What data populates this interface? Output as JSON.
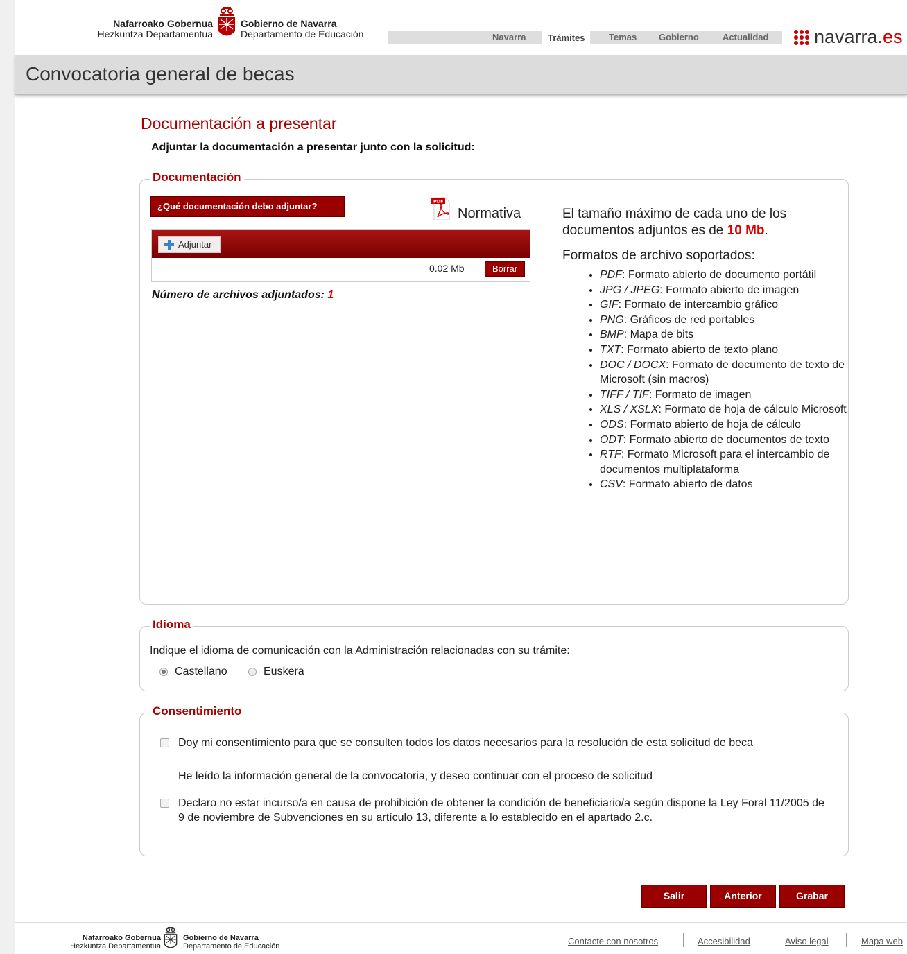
{
  "header": {
    "org_left_bold": "Nafarroako Gobernua",
    "org_left_sub": "Hezkuntza Departamentua",
    "org_right_bold": "Gobierno de Navarra",
    "org_right_sub": "Departamento de Educación",
    "nav": [
      "Navarra",
      "Trámites",
      "Temas",
      "Gobierno",
      "Actualidad"
    ],
    "brand_main": "navarra",
    "brand_suffix": ".es",
    "brand_color": "#cc0000"
  },
  "page_title": "Convocatoria general de becas",
  "section": {
    "title": "Documentación a presentar",
    "intro": "Adjuntar la documentación a presentar junto con la solicitud:"
  },
  "documentacion": {
    "legend": "Documentación",
    "help_button": "¿Qué documentación debo adjuntar?",
    "normativa": "Normativa",
    "pdf_icon_label": "PDF",
    "attach_button": "Adjuntar",
    "file_size": "0.02 Mb",
    "delete_button": "Borrar",
    "count_label": "Número de archivos adjuntados: ",
    "count_value": "1",
    "info_prefix": "El tamaño máximo de cada uno de los documentos adjuntos es de ",
    "info_max": "10 Mb",
    "info_suffix": ".",
    "formats_title": "Formatos de archivo soportados:",
    "formats": [
      {
        "ext": "PDF",
        "desc": ": Formato abierto de documento portátil"
      },
      {
        "ext": "JPG / JPEG",
        "desc": ": Formato abierto de imagen"
      },
      {
        "ext": "GIF",
        "desc": ": Formato de intercambio gráfico"
      },
      {
        "ext": "PNG",
        "desc": ": Gráficos de red portables"
      },
      {
        "ext": "BMP",
        "desc": ": Mapa de bits"
      },
      {
        "ext": "TXT",
        "desc": ": Formato abierto de texto plano"
      },
      {
        "ext": "DOC / DOCX",
        "desc": ": Formato de documento de texto de Microsoft (sin macros)"
      },
      {
        "ext": "TIFF / TIF",
        "desc": ": Formato de imagen"
      },
      {
        "ext": "XLS / XSLX",
        "desc": ": Formato de hoja de cálculo Microsoft"
      },
      {
        "ext": "ODS",
        "desc": ": Formato abierto de hoja de cálculo"
      },
      {
        "ext": "ODT",
        "desc": ": Formato abierto de documentos de texto"
      },
      {
        "ext": "RTF",
        "desc": ": Formato Microsoft para el intercambio de documentos multiplataforma"
      },
      {
        "ext": "CSV",
        "desc": ": Formato abierto de datos"
      }
    ]
  },
  "idioma": {
    "legend": "Idioma",
    "question": "Indique el idioma de comunicación con la Administración relacionadas con su trámite:",
    "options": [
      "Castellano",
      "Euskera"
    ],
    "selected": "Castellano"
  },
  "consentimiento": {
    "legend": "Consentimiento",
    "item1": "Doy mi consentimiento para que se consulten todos los datos necesarios para la resolución de esta solicitud de beca",
    "note": "He leído la información general de la convocatoria, y deseo continuar con el proceso de solicitud",
    "item2": "Declaro no estar incurso/a en causa de prohibición de obtener la condición de beneficiario/a según dispone la Ley Foral 11/2005 de 9 de noviembre de Subvenciones en su artículo 13, diferente a lo establecido en el apartado 2.c."
  },
  "actions": {
    "exit": "Salir",
    "previous": "Anterior",
    "save": "Grabar"
  },
  "footer": {
    "org_left_bold": "Nafarroako Gobernua",
    "org_left_sub": "Hezkuntza Departamentua",
    "org_right_bold": "Gobierno de Navarra",
    "org_right_sub": "Departamento de Educación",
    "links": [
      "Contacte con nosotros",
      "Accesibilidad",
      "Aviso legal",
      "Mapa web"
    ]
  },
  "colors": {
    "accent": "#9a0000",
    "legend_red": "#aa0000",
    "highlight_red": "#dd0000"
  }
}
